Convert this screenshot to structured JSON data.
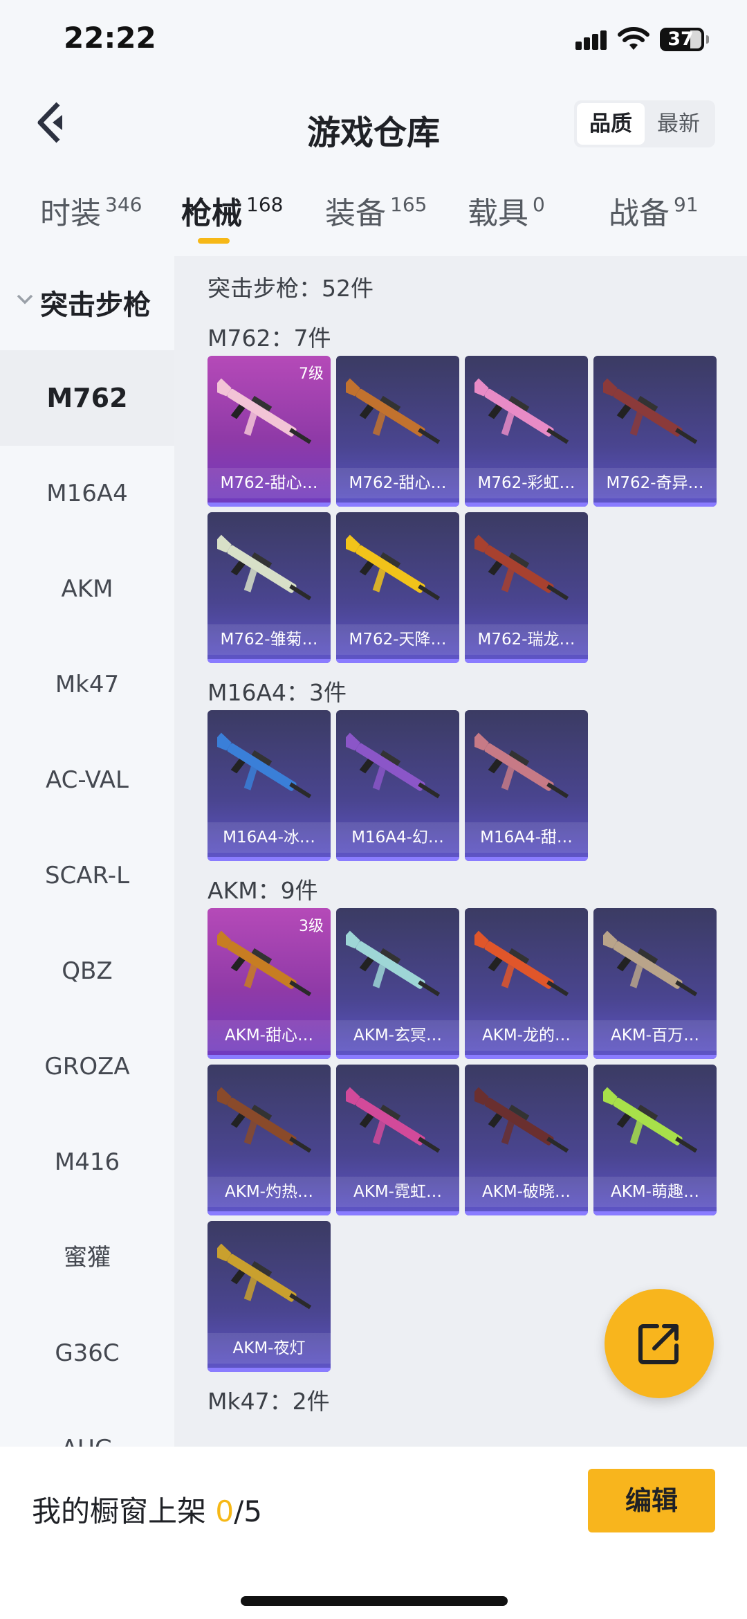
{
  "status": {
    "time": "22:22",
    "battery": "37"
  },
  "header": {
    "title": "游戏仓库",
    "sort_options": [
      "品质",
      "最新"
    ],
    "active_sort": "品质"
  },
  "tabs": [
    {
      "label": "时装",
      "count": "346"
    },
    {
      "label": "枪械",
      "count": "168"
    },
    {
      "label": "装备",
      "count": "165"
    },
    {
      "label": "载具",
      "count": "0"
    },
    {
      "label": "战备",
      "count": "91"
    }
  ],
  "active_tab": "枪械",
  "sidebar": {
    "category": "突击步枪",
    "items": [
      "M762",
      "M16A4",
      "AKM",
      "Mk47",
      "AC-VAL",
      "SCAR-L",
      "QBZ",
      "GROZA",
      "M416",
      "蜜獾",
      "G36C",
      "AUG"
    ],
    "active": "M762"
  },
  "content": {
    "summary": "突击步枪：52件",
    "sections": [
      {
        "title": "M762：7件",
        "items": [
          {
            "name": "M762-甜心…",
            "level": "7级",
            "premium": true,
            "color": "#f3c4d6"
          },
          {
            "name": "M762-甜心…",
            "color": "#c2722e"
          },
          {
            "name": "M762-彩虹…",
            "color": "#e88bc6"
          },
          {
            "name": "M762-奇异…",
            "color": "#8b3a3a"
          },
          {
            "name": "M762-雏菊…",
            "color": "#d8e0c8"
          },
          {
            "name": "M762-天降…",
            "color": "#f2c31a"
          },
          {
            "name": "M762-瑞龙…",
            "color": "#a8412f"
          }
        ]
      },
      {
        "title": "M16A4：3件",
        "items": [
          {
            "name": "M16A4-冰…",
            "color": "#3a7fd8"
          },
          {
            "name": "M16A4-幻…",
            "color": "#8b56c8"
          },
          {
            "name": "M16A4-甜…",
            "color": "#c77a86"
          }
        ]
      },
      {
        "title": "AKM：9件",
        "items": [
          {
            "name": "AKM-甜心…",
            "level": "3级",
            "premium": true,
            "color": "#c77d22"
          },
          {
            "name": "AKM-玄冥…",
            "color": "#9ed6d6"
          },
          {
            "name": "AKM-龙的…",
            "color": "#e0562a"
          },
          {
            "name": "AKM-百万…",
            "color": "#b9a48a"
          },
          {
            "name": "AKM-灼热…",
            "color": "#8a4a2a"
          },
          {
            "name": "AKM-霓虹…",
            "color": "#d24a9a"
          },
          {
            "name": "AKM-破晓…",
            "color": "#6a2f2f"
          },
          {
            "name": "AKM-萌趣…",
            "color": "#a8e04a"
          },
          {
            "name": "AKM-夜灯",
            "color": "#c9a02e"
          }
        ]
      },
      {
        "title": "Mk47：2件",
        "items": []
      }
    ]
  },
  "bottom": {
    "showcase_label": "我的橱窗上架 ",
    "used": "0",
    "total": "/5",
    "edit": "编辑"
  }
}
